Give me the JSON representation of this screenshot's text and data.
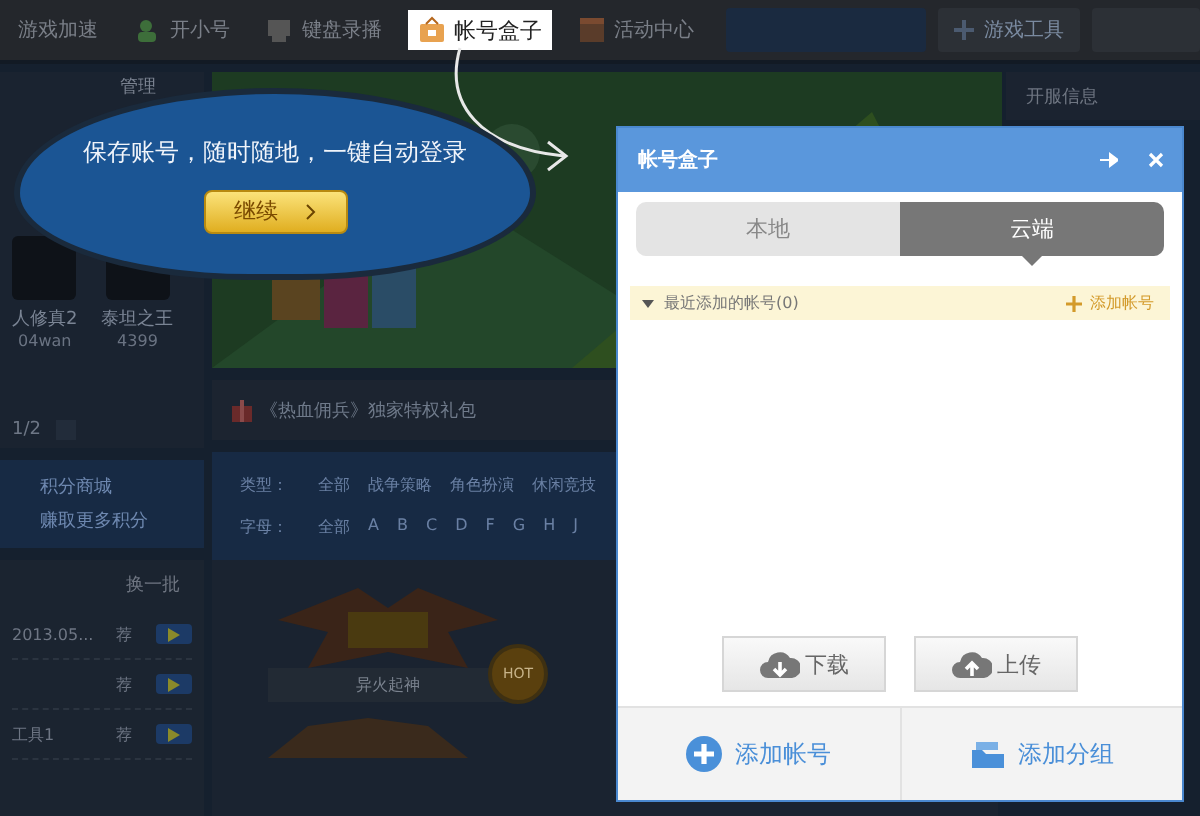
{
  "background_app": {
    "nav": [
      {
        "label": "游戏加速",
        "highlighted": false
      },
      {
        "label": "开小号",
        "highlighted": false
      },
      {
        "label": "键盘录播",
        "highlighted": false
      },
      {
        "label": "帐号盒子",
        "highlighted": true
      },
      {
        "label": "活动中心",
        "highlighted": false
      }
    ],
    "tool_button": "游戏工具",
    "panel_action": "管理",
    "games": [
      {
        "name": "人修真2",
        "source": "04wan"
      },
      {
        "name": "泰坦之王",
        "source": "4399"
      }
    ],
    "pager": "1/2",
    "gift_link": "《热血佣兵》独家特权礼包",
    "side_title": "开服信息",
    "points": [
      "积分商城",
      "赚取更多积分"
    ],
    "filters": [
      {
        "label": "类型：",
        "options": [
          "全部",
          "战争策略",
          "角色扮演",
          "休闲竞技"
        ]
      },
      {
        "label": "字母：",
        "options": [
          "全部",
          "A",
          "B",
          "C",
          "D",
          "F",
          "G",
          "H",
          "J"
        ]
      }
    ],
    "list_action": "换一批",
    "list_rows": [
      {
        "text": "2013.05...",
        "tag": "荐"
      },
      {
        "text": "",
        "tag": "荐"
      },
      {
        "text": "工具1",
        "tag": "荐"
      }
    ],
    "featured": {
      "badge": "HOT",
      "subtitle": "异火起神"
    }
  },
  "tooltip": {
    "message": "保存账号，随时随地，一键自动登录",
    "button": "继续"
  },
  "dialog": {
    "title": "帐号盒子",
    "tabs": [
      {
        "label": "本地",
        "selected": false
      },
      {
        "label": "云端",
        "selected": true
      }
    ],
    "group": {
      "label": "最近添加的帐号(0)",
      "expanded": true,
      "action": "添加帐号"
    },
    "sync_buttons": [
      {
        "label": "下载",
        "kind": "download"
      },
      {
        "label": "上传",
        "kind": "upload"
      }
    ],
    "footer_buttons": [
      {
        "label": "添加帐号",
        "kind": "account"
      },
      {
        "label": "添加分组",
        "kind": "group"
      }
    ]
  }
}
